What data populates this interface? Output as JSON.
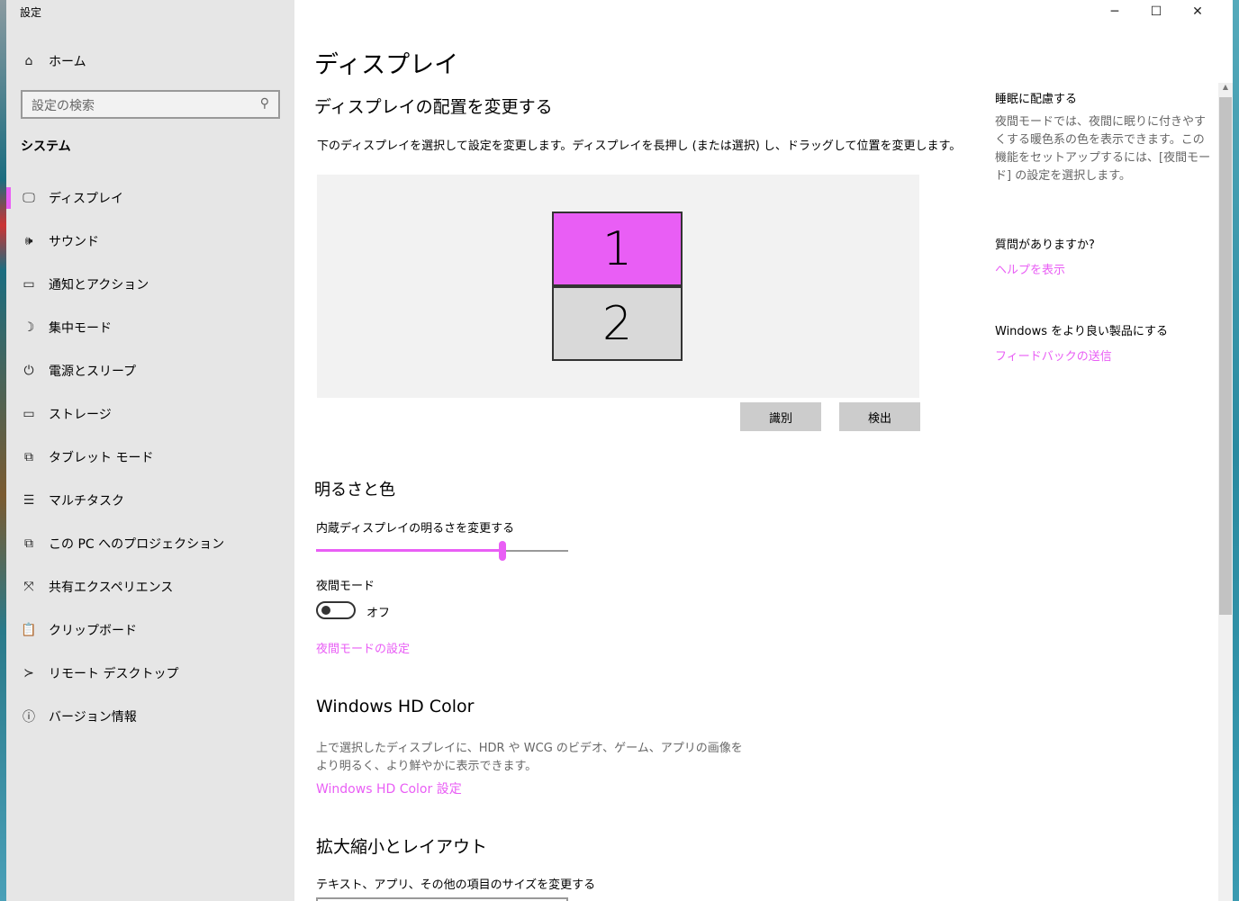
{
  "window": {
    "title": "設定",
    "controls": {
      "minimize": "─",
      "maximize": "☐",
      "close": "✕"
    }
  },
  "sidebar": {
    "home": "ホーム",
    "search_placeholder": "設定の検索",
    "section": "システム",
    "items": [
      {
        "label": "ディスプレイ",
        "icon": "🖵"
      },
      {
        "label": "サウンド",
        "icon": "🕪"
      },
      {
        "label": "通知とアクション",
        "icon": "▭"
      },
      {
        "label": "集中モード",
        "icon": "☽"
      },
      {
        "label": "電源とスリープ",
        "icon": "⏻"
      },
      {
        "label": "ストレージ",
        "icon": "▭"
      },
      {
        "label": "タブレット モード",
        "icon": "⧉"
      },
      {
        "label": "マルチタスク",
        "icon": "☰"
      },
      {
        "label": "この PC へのプロジェクション",
        "icon": "⧉"
      },
      {
        "label": "共有エクスペリエンス",
        "icon": "⤧"
      },
      {
        "label": "クリップボード",
        "icon": "📋"
      },
      {
        "label": "リモート デスクトップ",
        "icon": "≻"
      },
      {
        "label": "バージョン情報",
        "icon": "ⓘ"
      }
    ]
  },
  "main": {
    "title": "ディスプレイ",
    "arrange_heading": "ディスプレイの配置を変更する",
    "arrange_desc": "下のディスプレイを選択して設定を変更します。ディスプレイを長押し (または選択) し、ドラッグして位置を変更します。",
    "monitors": [
      "1",
      "2"
    ],
    "identify": "識別",
    "detect": "検出",
    "brightness_heading": "明るさと色",
    "brightness_label": "内蔵ディスプレイの明るさを変更する",
    "brightness_value": 74,
    "night_label": "夜間モード",
    "night_state": "オフ",
    "night_link": "夜間モードの設定",
    "hd_heading": "Windows HD Color",
    "hd_desc1": "上で選択したディスプレイに、HDR や WCG のビデオ、ゲーム、アプリの画像を",
    "hd_desc2": "より明るく、より鮮やかに表示できます。",
    "hd_link": "Windows HD Color 設定",
    "scale_heading": "拡大縮小とレイアウト",
    "scale_label": "テキスト、アプリ、その他の項目のサイズを変更する"
  },
  "right": {
    "sleep_title": "睡眠に配慮する",
    "sleep_desc": "夜間モードでは、夜間に眠りに付きやすくする暖色系の色を表示できます。この機能をセットアップするには、[夜間モード] の設定を選択します。",
    "q_title": "質問がありますか?",
    "q_link": "ヘルプを表示",
    "fb_title": "Windows をより良い製品にする",
    "fb_link": "フィードバックの送信"
  },
  "accent": "#e95ef5"
}
